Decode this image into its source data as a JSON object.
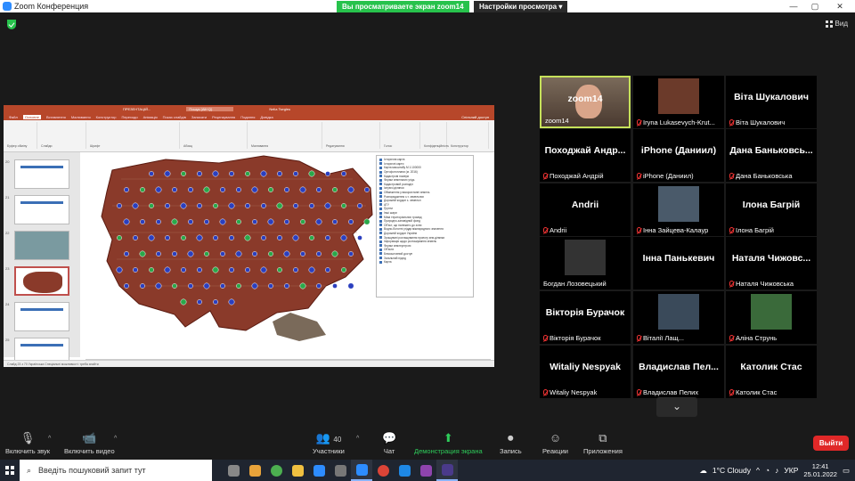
{
  "window": {
    "title": "Zoom Конференция",
    "share_banner": "Вы просматриваете экран zoom14",
    "view_options": "Настройки просмотра"
  },
  "view_button": "Вид",
  "powerpoint": {
    "title_fragment": "ПРЕЗЕНТАЦІЙ...",
    "search_placeholder": "Пошук (Alt+Q)",
    "user": "Nelia Tsegleu",
    "tabs": [
      "Файл",
      "Основне",
      "Вставлення",
      "Малювання",
      "Конструктор",
      "Переходи",
      "Анімація",
      "Показ слайдів",
      "Записати",
      "Рецензування",
      "Подання",
      "Довідка"
    ],
    "share": "Спільний доступ",
    "ribbon_groups": [
      "Буфер обміну",
      "Слайди",
      "Шрифт",
      "Абзац",
      "Малювання",
      "Редагування",
      "Голос",
      "Конфіденційність",
      "Конструктор"
    ],
    "slide_numbers": [
      "20",
      "21",
      "22",
      "23",
      "24",
      "25"
    ],
    "notes": "Нотатки до слайда",
    "status": "Слайд 23 з 70   Українська   Спеціальні можливості: треба знайти",
    "legend_items": [
      "Історична карта",
      "Історичні карти",
      "Карта масштабу М 1:100000",
      "Ортофотоплани (м. 2016)",
      "Кадастрові номери",
      "Форми земельних угідь",
      "Кадастровий розподіл",
      "Існуючі ділянки",
      "Обмеження у використанні земель",
      "Розпорядження з.т. земельних",
      "Дорожній кордон з. земельн",
      "АТУ",
      "Ґрунти",
      "Інші шари",
      "Межі територіальних громад",
      "Природно-заповідний фонд",
      "Об'єкт, що належить до зони",
      "Водно-болотні угіддя міжнародного значення",
      "Дорожній кордон України",
      "Зрошувані розташування проекту зем.ділянки",
      "Інформація щодо розташування земель",
      "Форми землеустрою",
      "Об'єкти",
      "Безкоштовний доступ",
      "Загальний підхід",
      "Карта"
    ]
  },
  "participants": [
    {
      "name": "zoom14",
      "label": "zoom14",
      "active": true,
      "muted": false,
      "video": "webcam"
    },
    {
      "name": "",
      "label": "Iryna Lukasevych-Krut...",
      "active": false,
      "muted": true,
      "video": "photo"
    },
    {
      "name": "Віта Шукалович",
      "label": "Віта Шукалович",
      "active": false,
      "muted": true,
      "video": "none"
    },
    {
      "name": "Походжай Андр...",
      "label": "Походжай Андрій",
      "active": false,
      "muted": true,
      "video": "none"
    },
    {
      "name": "iPhone (Даниил)",
      "label": "iPhone (Даниил)",
      "active": false,
      "muted": true,
      "video": "none"
    },
    {
      "name": "Дана Баньковсь...",
      "label": "Дана Баньковська",
      "active": false,
      "muted": true,
      "video": "none"
    },
    {
      "name": "Andrii",
      "label": "Andrii",
      "active": false,
      "muted": true,
      "video": "none"
    },
    {
      "name": "",
      "label": "Інна Зайцева-Калаур",
      "active": false,
      "muted": true,
      "video": "photo"
    },
    {
      "name": "Ілона Багрій",
      "label": "Ілона Багрій",
      "active": false,
      "muted": true,
      "video": "none"
    },
    {
      "name": "",
      "label": "Богдан Лозовецький",
      "active": false,
      "muted": false,
      "video": "photo"
    },
    {
      "name": "Інна Панькевич",
      "label": "",
      "active": false,
      "muted": false,
      "video": "none"
    },
    {
      "name": "Наталя Чижовс...",
      "label": "Наталя Чижовська",
      "active": false,
      "muted": true,
      "video": "none"
    },
    {
      "name": "Вікторія Бурачок",
      "label": "Вікторія Бурачок",
      "active": false,
      "muted": true,
      "video": "none"
    },
    {
      "name": "",
      "label": "Віталії Лащ...",
      "active": false,
      "muted": true,
      "video": "photo"
    },
    {
      "name": "",
      "label": "Аліна Струнь",
      "active": false,
      "muted": true,
      "video": "photo"
    },
    {
      "name": "Witaliy Nespyak",
      "label": "Witaliy Nespyak",
      "active": false,
      "muted": true,
      "video": "none"
    },
    {
      "name": "Владислав Пел...",
      "label": "Владислав Пелих",
      "active": false,
      "muted": true,
      "video": "none"
    },
    {
      "name": "Католик Стас",
      "label": "Католик Стас",
      "active": false,
      "muted": true,
      "video": "none"
    }
  ],
  "toolbar": {
    "mute": "Включить звук",
    "video": "Включить видео",
    "participants": "Участники",
    "participants_count": "40",
    "chat": "Чат",
    "share": "Демонстрация экрана",
    "record": "Запись",
    "reactions": "Реакции",
    "apps": "Приложения",
    "leave": "Выйти"
  },
  "taskbar": {
    "search_placeholder": "Введіть пошуковий запит тут",
    "weather": "1°C  Cloudy",
    "language": "УКР",
    "time": "12:41",
    "date": "25.01.2022"
  },
  "colors": {
    "accent_green": "#27c24c",
    "active_border": "#c6e15a",
    "leave_red": "#e02828",
    "ppt_red": "#b7472a",
    "map_brown": "#8a3a2a"
  }
}
